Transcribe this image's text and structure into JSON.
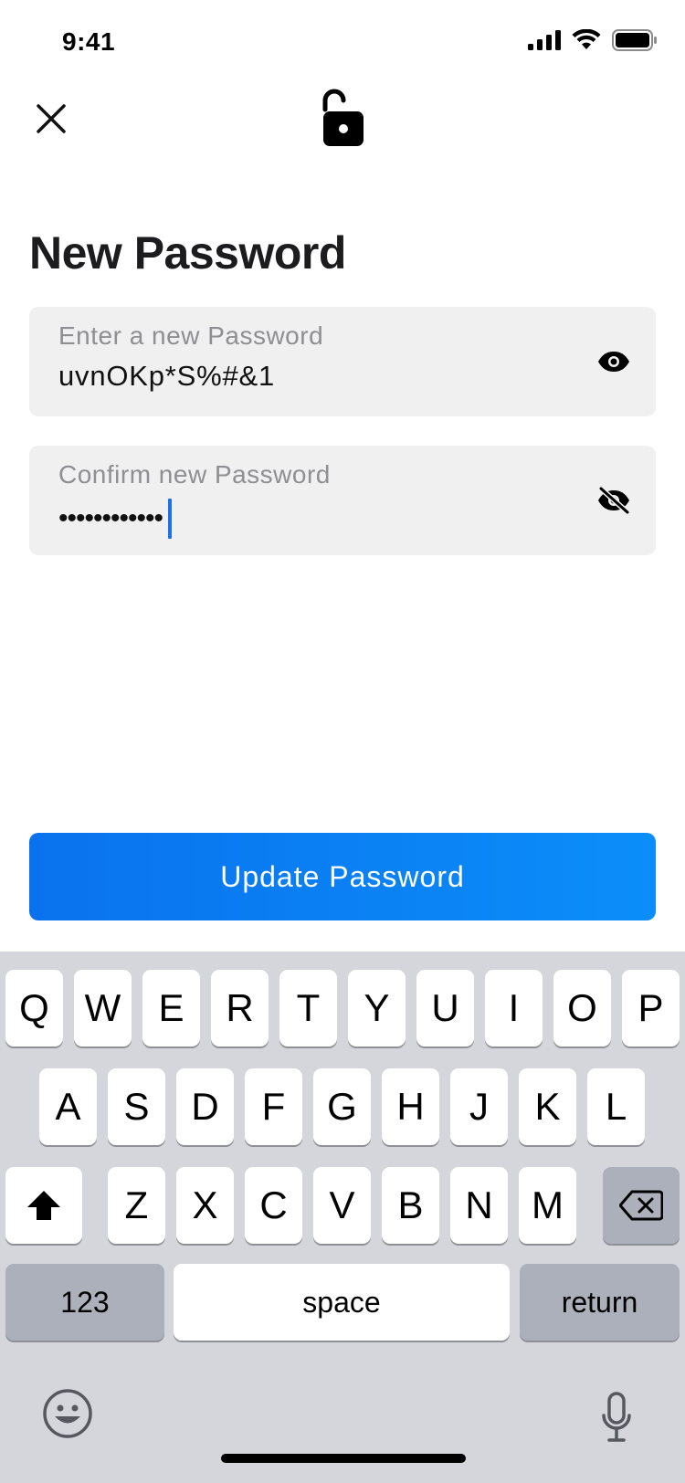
{
  "status_bar": {
    "time": "9:41"
  },
  "header": {
    "close_icon": "close-icon",
    "lock_icon": "unlock-icon"
  },
  "page": {
    "title": "New Password"
  },
  "fields": {
    "new_password": {
      "label": "Enter a new Password",
      "value": "uvnOKp*S%#&1",
      "visibility_icon": "eye-icon"
    },
    "confirm_password": {
      "label": "Confirm new Password",
      "masked_value": "••••••••••••",
      "visibility_icon": "eye-off-icon"
    }
  },
  "actions": {
    "update_label": "Update Password"
  },
  "keyboard": {
    "row1": [
      "Q",
      "W",
      "E",
      "R",
      "T",
      "Y",
      "U",
      "I",
      "O",
      "P"
    ],
    "row2": [
      "A",
      "S",
      "D",
      "F",
      "G",
      "H",
      "J",
      "K",
      "L"
    ],
    "row3": [
      "Z",
      "X",
      "C",
      "V",
      "B",
      "N",
      "M"
    ],
    "numbers_label": "123",
    "space_label": "space",
    "return_label": "return"
  },
  "colors": {
    "accent_start": "#0a72ee",
    "accent_end": "#0b8ef9",
    "field_bg": "#f0f0f0",
    "keyboard_bg": "#d4d6dc",
    "cursor": "#1a73e8"
  }
}
